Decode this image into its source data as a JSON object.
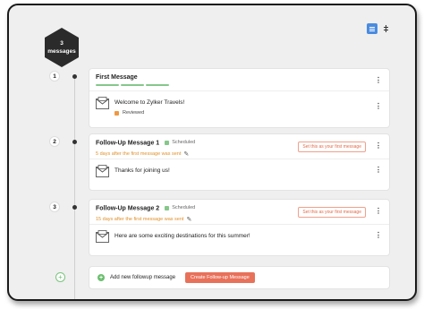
{
  "badge": {
    "count": "3",
    "label": "messages"
  },
  "messages": [
    {
      "number": "1",
      "title": "First Message",
      "body": "Welcome to Zylker Travels!",
      "status": "Reviewed"
    },
    {
      "number": "2",
      "title": "Follow-Up Message 1",
      "scheduled": "Scheduled",
      "delay": "5 days after the first message was sent",
      "set_first": "Set this as your first message",
      "body": "Thanks for joining us!"
    },
    {
      "number": "3",
      "title": "Follow-Up Message 2",
      "scheduled": "Scheduled",
      "delay": "15 days after the first message was sent",
      "set_first": "Set this as your first message",
      "body": "Here are some exciting destinations for this summer!"
    }
  ],
  "add": {
    "label": "Add new followup message",
    "button": "Create Follow-up Message"
  },
  "colors": {
    "accent": "#e8715a",
    "scheduled": "#86c78a",
    "delay": "#e0912b",
    "reviewed": "#f09840",
    "toggle": "#4a8be0"
  },
  "icons": {
    "message": "envelope-icon",
    "menu": "kebab-icon",
    "edit": "pencil-icon",
    "add": "plus-icon"
  }
}
